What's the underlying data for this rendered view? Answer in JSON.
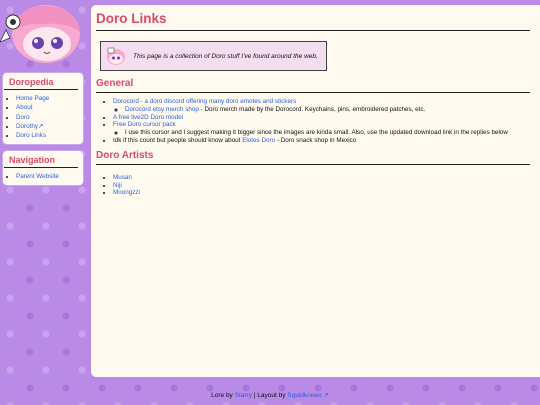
{
  "sidebar": {
    "doropedia": {
      "title": "Doropedia",
      "items": [
        "Home Page",
        "About",
        "Doro",
        "Dorothy↗",
        "Doro Links"
      ]
    },
    "navigation": {
      "title": "Navigation",
      "items": [
        "Parent Website"
      ]
    }
  },
  "main": {
    "title": "Doro Links",
    "notice": "This page is a collection of Doro stuff I've found around the web.",
    "general": {
      "heading": "General",
      "dorocord_link": "Dorocord - a doro discord offering many doro emotes and stickers",
      "etsy_link": "Dorocord etsy merch shop",
      "etsy_desc": " - Doro merch made by the Dorocord. Keychains, pins, embroidered patches, etc.",
      "live2d_link": "A free live2D Doro model",
      "cursor_link": "Free Doro cursor pack",
      "cursor_desc": "I use this cursor and I suggest making it bigger since the images are kinda small. Also, use the updated download link in the replies below",
      "idk_text": "Idk if this count but people should know about ",
      "elotes_link": "Elotes Doro",
      "elotes_desc": " - Doro snack shop in Mexico"
    },
    "artists": {
      "heading": "Doro Artists",
      "items": [
        "Musan",
        "Niji",
        "Moongzzi"
      ]
    }
  },
  "footer": {
    "lore_prefix": "Lore by ",
    "lore_author": "Starry",
    "layout_prefix": " | Layout by ",
    "layout_author": "Squidkneeo ↗"
  },
  "colors": {
    "background": "#b98ae6",
    "panel": "#fffaf0",
    "heading": "#d84a6e",
    "link": "#2b5fd9",
    "notice_bg": "#f3ddef"
  },
  "icons": {
    "mascot": "doro-mascot-icon",
    "notice": "doro-notice-icon"
  }
}
